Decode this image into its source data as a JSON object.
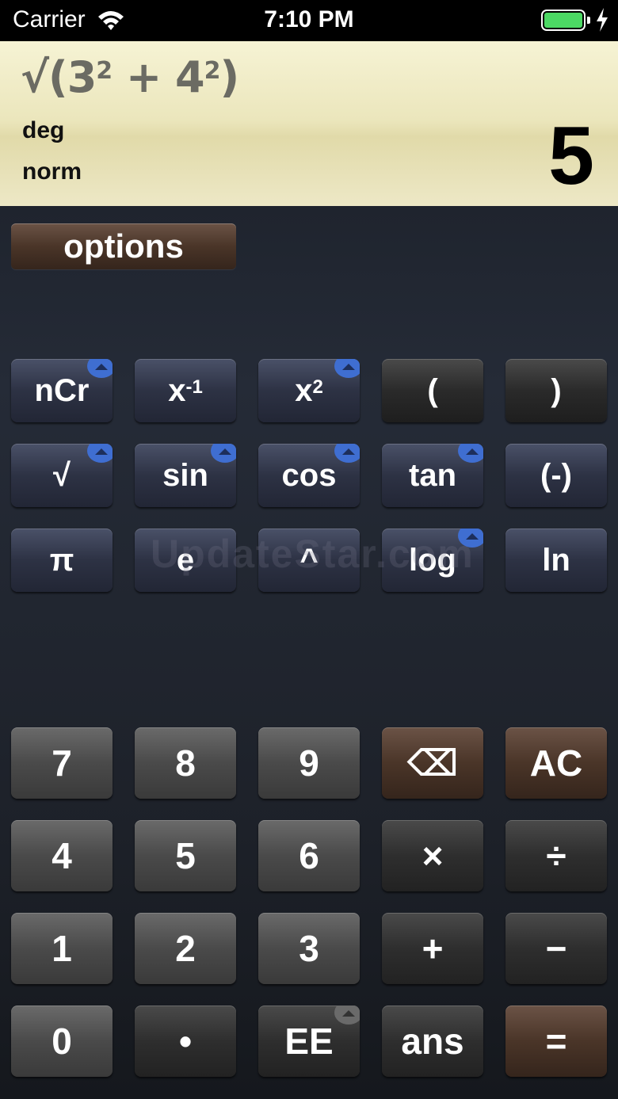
{
  "status_bar": {
    "carrier": "Carrier",
    "time": "7:10 PM",
    "battery_color": "#4cd964"
  },
  "display": {
    "expression_parts": {
      "root": "√(3",
      "exp1": "2",
      "mid": " + 4",
      "exp2": "2",
      "end": ")"
    },
    "angle_mode": "deg",
    "number_mode": "norm",
    "result": "5"
  },
  "options_label": "options",
  "watermark": "UpdateStar.com",
  "function_keys": {
    "ncr": "nCr",
    "x_inv_base": "x",
    "x_inv_exp": "-1",
    "x_sq_base": "x",
    "x_sq_exp": "2",
    "lparen": "(",
    "rparen": ")",
    "sqrt": "√",
    "sin": "sin",
    "cos": "cos",
    "tan": "tan",
    "neg": "(-)",
    "pi": "π",
    "e": "e",
    "pow": "^",
    "log": "log",
    "ln": "ln"
  },
  "keypad": {
    "k7": "7",
    "k8": "8",
    "k9": "9",
    "backspace": "⌫",
    "ac": "AC",
    "k4": "4",
    "k5": "5",
    "k6": "6",
    "mul": "×",
    "div": "÷",
    "k1": "1",
    "k2": "2",
    "k3": "3",
    "add": "+",
    "sub": "−",
    "k0": "0",
    "dot": "•",
    "ee": "EE",
    "ans": "ans",
    "eq": "="
  },
  "colors": {
    "fn_key": "#2d3244",
    "brown_key": "#4a3528",
    "corner_badge": "#3f6ed1"
  }
}
